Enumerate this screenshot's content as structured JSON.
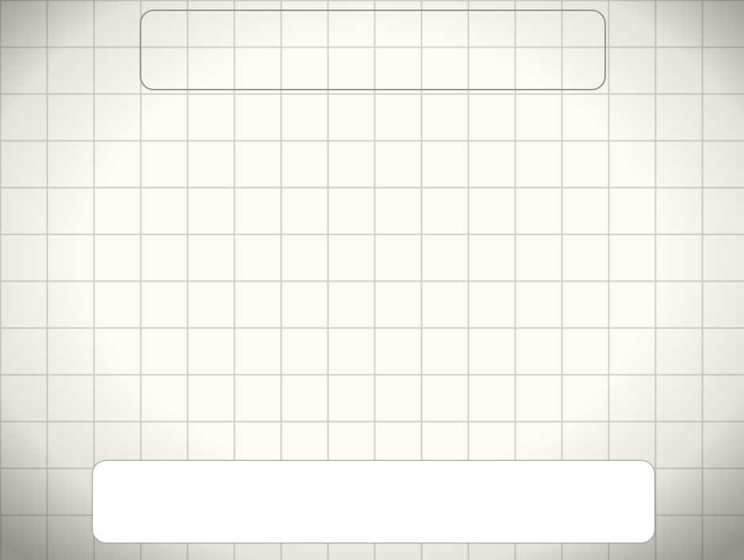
{
  "theme": {
    "paper_color": "#fdfbf4",
    "grid_line_color": "#d6d0cc",
    "panel_border_color": "#9a9894",
    "bottom_panel_fill": "#ffffff"
  },
  "top_panel": {
    "text": ""
  },
  "bottom_panel": {
    "text": ""
  }
}
